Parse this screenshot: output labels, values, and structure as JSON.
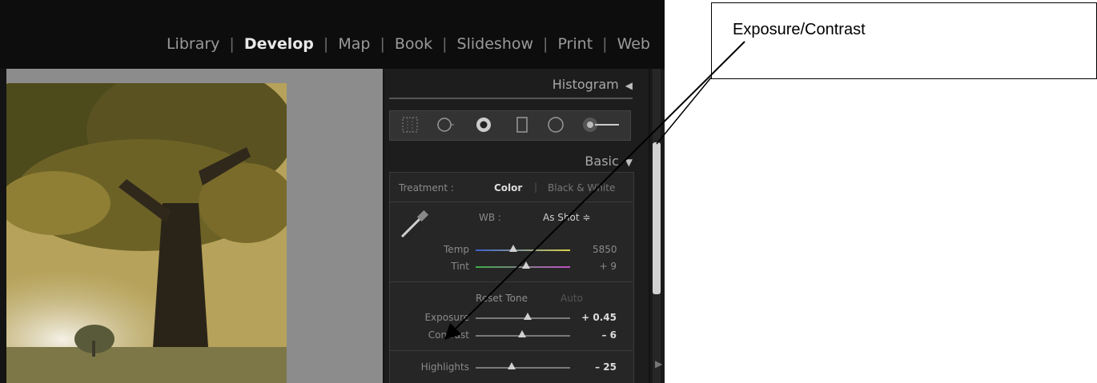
{
  "modules": [
    "Library",
    "Develop",
    "Map",
    "Book",
    "Slideshow",
    "Print",
    "Web"
  ],
  "active_module": "Develop",
  "panels": {
    "histogram": {
      "label": "Histogram",
      "collapse_icon": "triangle-left-icon"
    },
    "basic": {
      "label": "Basic",
      "collapse_icon": "triangle-down-icon"
    }
  },
  "tools": [
    "crop-overlay-icon",
    "spot-removal-icon",
    "red-eye-icon",
    "graduated-filter-icon",
    "radial-filter-icon",
    "adjustment-brush-icon"
  ],
  "treatment": {
    "label": "Treatment :",
    "color": "Color",
    "bw": "Black & White"
  },
  "wb": {
    "label": "WB :",
    "value": "As Shot ≑"
  },
  "temp": {
    "label": "Temp",
    "value": "5850",
    "level": 0.4
  },
  "tint": {
    "label": "Tint",
    "value": "+ 9",
    "level": 0.53
  },
  "tone": {
    "label": "Reset Tone",
    "auto": "Auto"
  },
  "exposure": {
    "label": "Exposure",
    "value": "+ 0.45",
    "level": 0.55
  },
  "contrast": {
    "label": "Contrast",
    "value": "– 6",
    "level": 0.49
  },
  "highlights": {
    "label": "Highlights",
    "value": "– 25",
    "level": 0.38
  },
  "callout": "Exposure/Contrast",
  "colors": {
    "bg_dark": "#141414",
    "panel": "#262626",
    "accent_text": "#dcdcdc"
  }
}
